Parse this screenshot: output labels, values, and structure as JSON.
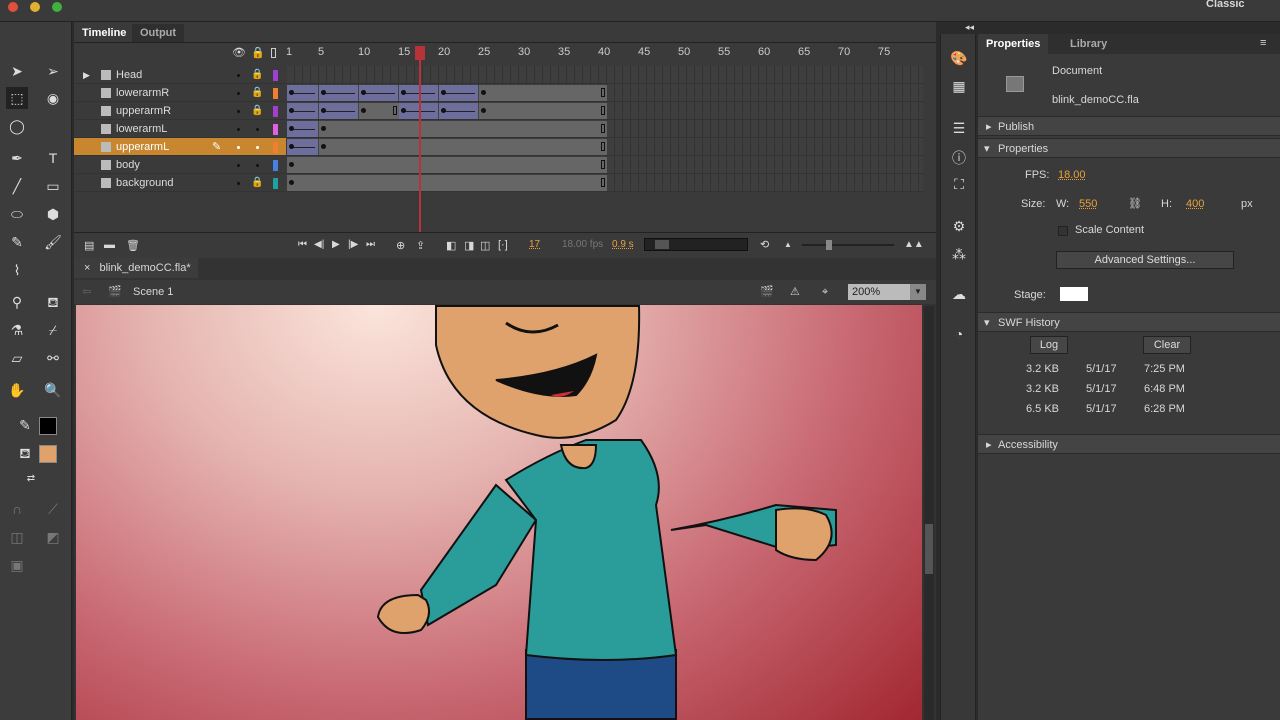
{
  "topbar": {
    "workspace": "Classic"
  },
  "timeline": {
    "tabs": [
      "Timeline",
      "Output"
    ],
    "ticks": [
      1,
      5,
      10,
      15,
      20,
      25,
      30,
      35,
      40,
      45,
      50,
      55,
      60,
      65,
      70,
      75
    ],
    "playhead_frame": 17,
    "layers": [
      {
        "name": "Head",
        "type": "folder",
        "locked": true,
        "color": "#a040d0",
        "tweens": [],
        "keyframes": [],
        "end": 0
      },
      {
        "name": "lowerarmR",
        "locked": true,
        "color": "#f08030",
        "tweens": [
          [
            1,
            4
          ],
          [
            5,
            9
          ],
          [
            10,
            14
          ],
          [
            15,
            19
          ],
          [
            20,
            24
          ]
        ],
        "keyframes": [
          25
        ],
        "end": 40
      },
      {
        "name": "upperarmR",
        "locked": true,
        "color": "#a040d0",
        "tweens": [
          [
            1,
            4
          ],
          [
            5,
            9
          ],
          [
            15,
            19
          ],
          [
            20,
            24
          ]
        ],
        "keyframes": [
          10,
          25
        ],
        "static_end": 14,
        "end": 40
      },
      {
        "name": "lowerarmL",
        "locked": false,
        "color": "#e060e0",
        "tweens": [
          [
            1,
            4
          ]
        ],
        "keyframes": [
          5
        ],
        "end": 40
      },
      {
        "name": "upperarmL",
        "locked": false,
        "selected": true,
        "color": "#f08030",
        "tweens": [
          [
            1,
            4
          ]
        ],
        "keyframes": [
          5
        ],
        "end": 40
      },
      {
        "name": "body",
        "locked": false,
        "color": "#4a80e0",
        "tweens": [],
        "keyframes": [
          1
        ],
        "end": 40
      },
      {
        "name": "background",
        "locked": true,
        "color": "#20a0a0",
        "tweens": [],
        "keyframes": [
          1
        ],
        "end": 40
      }
    ],
    "current_frame": "17",
    "fps": "18.00 fps",
    "time": "0.9 s"
  },
  "document": {
    "tab": "blink_demoCC.fla*",
    "scene": "Scene 1",
    "zoom": "200%"
  },
  "properties": {
    "tabs": [
      "Properties",
      "Library"
    ],
    "doc_type": "Document",
    "doc_name": "blink_demoCC.fla",
    "publish": "Publish",
    "properties_section": "Properties",
    "fps_label": "FPS:",
    "fps": "18.00",
    "size_label": "Size:",
    "w_label": "W:",
    "w": "550",
    "h_label": "H:",
    "h": "400",
    "unit": "px",
    "scale_content": "Scale Content",
    "advanced": "Advanced Settings...",
    "stage_label": "Stage:",
    "stage_color": "#ffffff",
    "swf_history": "SWF History",
    "log": "Log",
    "clear": "Clear",
    "history": [
      [
        "3.2 KB",
        "5/1/17",
        "7:25 PM"
      ],
      [
        "3.2 KB",
        "5/1/17",
        "6:48 PM"
      ],
      [
        "6.5 KB",
        "5/1/17",
        "6:28 PM"
      ]
    ],
    "accessibility": "Accessibility"
  }
}
